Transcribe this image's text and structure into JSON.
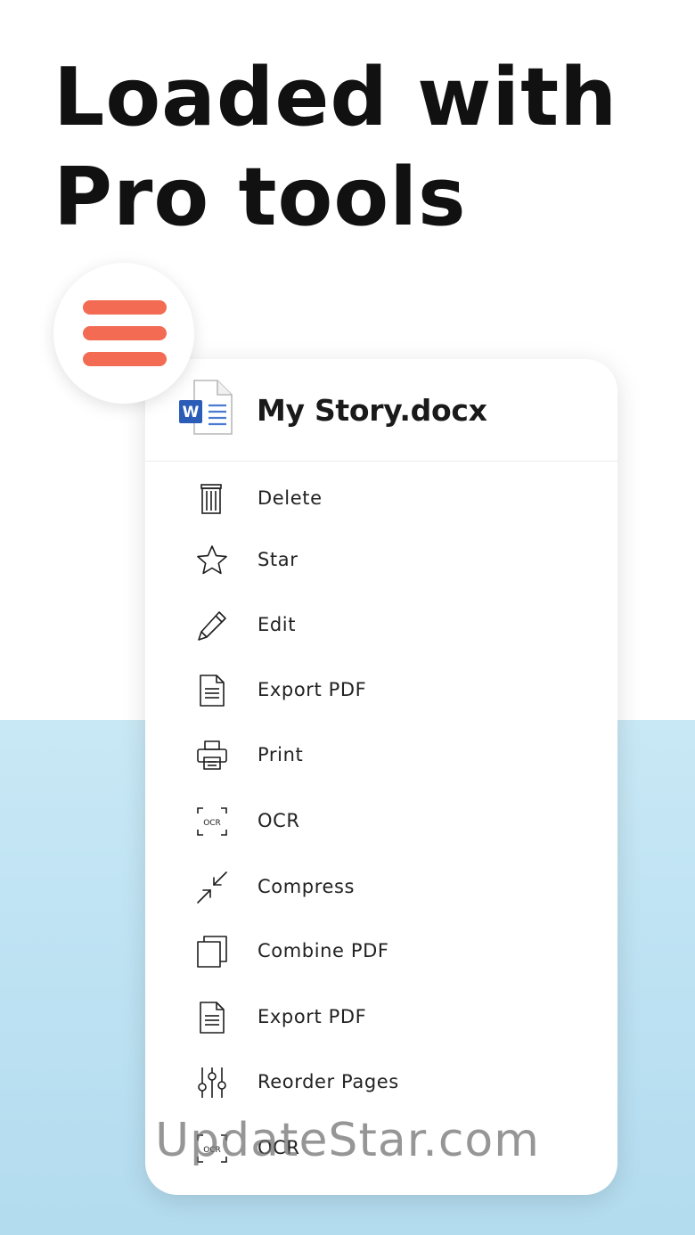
{
  "headline": {
    "line1": "Loaded with",
    "line2": "Pro tools"
  },
  "colors": {
    "accent": "#f26b52",
    "word_blue": "#2b5cb8",
    "background_band": "#bfe3f3"
  },
  "menu_button": {
    "icon": "hamburger-menu-icon"
  },
  "card": {
    "file_icon": "word-document-icon",
    "file_name": "My Story.docx",
    "items": [
      {
        "label": "Delete",
        "icon": "trash-icon"
      },
      {
        "label": "Star",
        "icon": "star-icon"
      },
      {
        "label": "Edit",
        "icon": "pencil-icon"
      },
      {
        "label": "Export PDF",
        "icon": "document-icon"
      },
      {
        "label": "Print",
        "icon": "printer-icon"
      },
      {
        "label": "OCR",
        "icon": "ocr-scan-icon"
      },
      {
        "label": "Compress",
        "icon": "compress-arrows-icon"
      },
      {
        "label": "Combine PDF",
        "icon": "stacked-pages-icon"
      },
      {
        "label": "Export PDF",
        "icon": "document-icon"
      },
      {
        "label": "Reorder Pages",
        "icon": "sliders-icon"
      },
      {
        "label": "OCR",
        "icon": "ocr-scan-icon"
      }
    ]
  },
  "watermark": "UpdateStar.com"
}
